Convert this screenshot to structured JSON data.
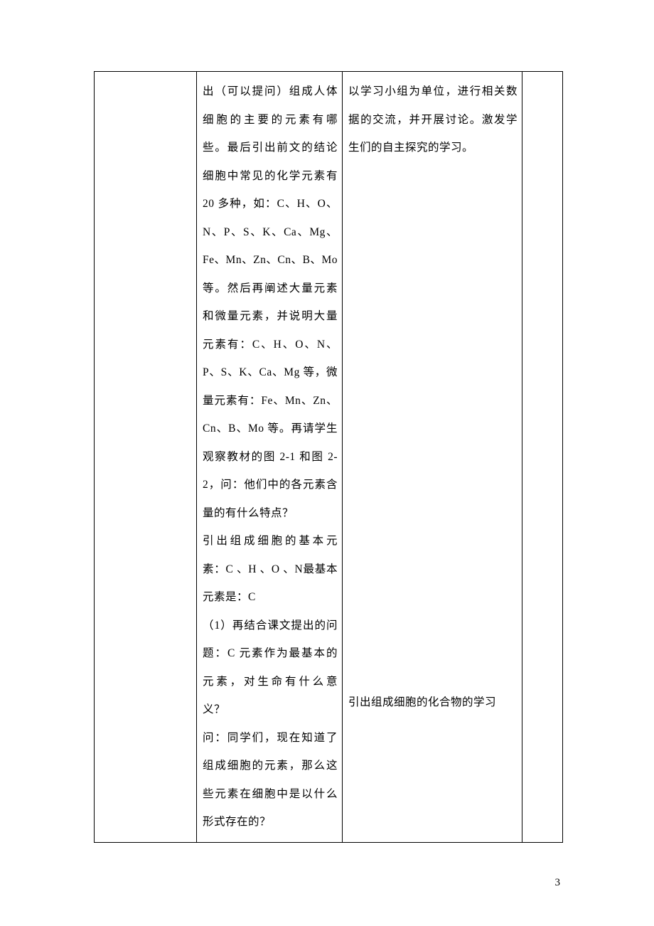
{
  "table": {
    "row": {
      "col1": "",
      "col2": {
        "p1": "出（可以提问）组成人体细胞的主要的元素有哪些。最后引出前文的结论 细胞中常见的化学元素有 20 多种，如：C、H、O、N、P、S、K、Ca、Mg、Fe、Mn、Zn、Cn、B、Mo 等。然后再阐述大量元素和微量元素，并说明大量元素有：C、H、O、N、P、S、K、Ca、Mg 等，微量元素有：Fe、Mn、Zn、Cn、B、Mo 等。再请学生观察教材的图 2-1 和图 2-2，问：他们中的各元素含量的有什么特点？",
        "p2": "引出组成细胞的基本元素：C 、H 、O 、N最基本元素是：C",
        "p3": "（1）再结合课文提出的问题：C 元素作为最基本的元素，对生命有什么意义？",
        "p4": "问：同学们，现在知道了组成细胞的元素，那么这些元素在细胞中是以什么形式存在的？"
      },
      "col3": {
        "p1": "以学习小组为单位，进行相关数据的交流，并开展讨论。激发学生们的自主探究的学习。",
        "p2": "引出组成细胞的化合物的学习"
      },
      "col4": ""
    }
  },
  "pageNumber": "3"
}
